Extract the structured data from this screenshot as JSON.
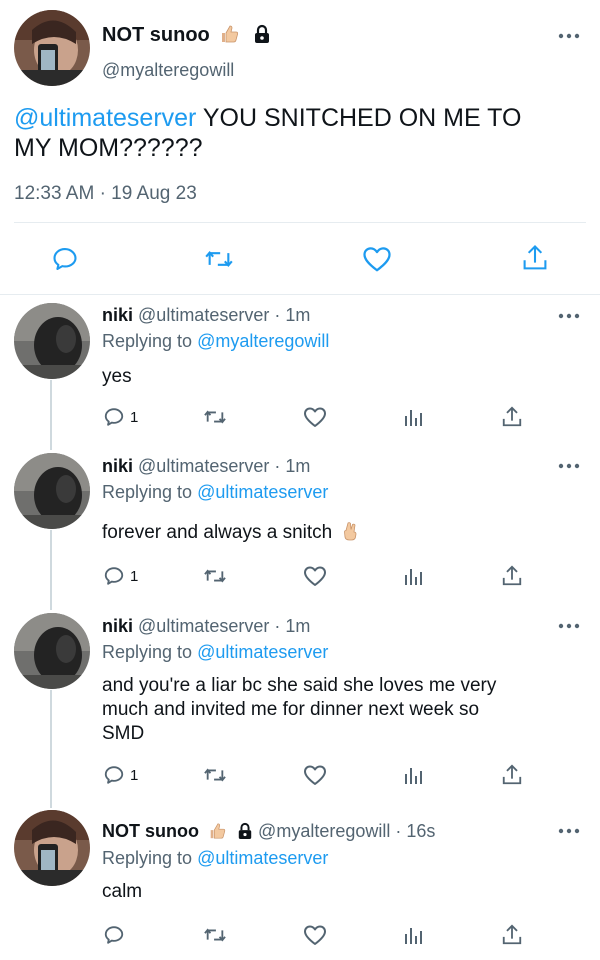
{
  "main_tweet": {
    "display_name": "NOT sunoo",
    "handle": "@myalteregowill",
    "mention": "@ultimateserver",
    "text_line1": "YOU SNITCHED ON ME TO",
    "text_line2": "MY MOM??????",
    "time": "12:33 AM",
    "dot": "·",
    "date": "19 Aug 23"
  },
  "replies": [
    {
      "name": "niki",
      "handle": "@ultimateserver",
      "time": "1m",
      "replying_label": "Replying to",
      "replying_to": "@myalteregowill",
      "lines": [
        "yes"
      ],
      "reply_count": "1"
    },
    {
      "name": "niki",
      "handle": "@ultimateserver",
      "time": "1m",
      "replying_label": "Replying to",
      "replying_to": "@ultimateserver",
      "lines": [
        "forever and always a snitch"
      ],
      "reply_count": "1"
    },
    {
      "name": "niki",
      "handle": "@ultimateserver",
      "time": "1m",
      "replying_label": "Replying to",
      "replying_to": "@ultimateserver",
      "lines": [
        "and you're a liar bc she said she loves me very",
        "much and invited me for dinner next week so",
        "SMD"
      ],
      "reply_count": "1"
    },
    {
      "name": "NOT sunoo",
      "handle": "@myalteregowill",
      "time": "16s",
      "replying_label": "Replying to",
      "replying_to": "@ultimateserver",
      "lines": [
        "calm"
      ],
      "reply_count": ""
    }
  ],
  "sep": "·",
  "colors": {
    "link": "#1d9bf0",
    "secondary": "#536471",
    "text": "#0f1419",
    "divider": "#e6ecf0"
  }
}
